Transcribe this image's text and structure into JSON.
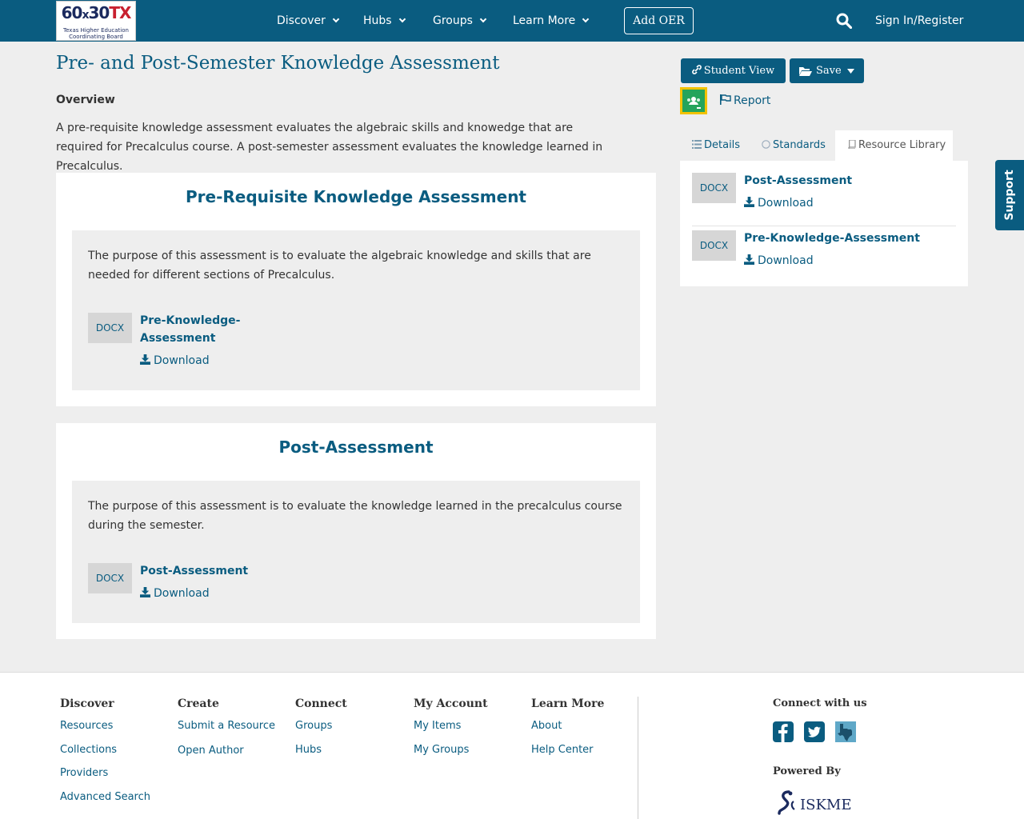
{
  "header": {
    "logo": {
      "line1": "60",
      "x": "x",
      "line2": "30",
      "tx": "TX",
      "sub1": "Texas Higher Education",
      "sub2": "Coordinating Board"
    },
    "nav": [
      "Discover",
      "Hubs",
      "Groups",
      "Learn More"
    ],
    "add_oer": "Add OER",
    "sign_in": "Sign In/Register"
  },
  "page": {
    "title": "Pre- and Post-Semester Knowledge Assessment",
    "overview_label": "Overview",
    "overview_text": "A pre-requisite knowledge assessment evaluates the algebraic skills and knowedge that are required for Precalculus course. A post-semester assessment evaluates the knowledge learned in Precalculus."
  },
  "sections": [
    {
      "title": "Pre-Requisite Knowledge Assessment",
      "description": "The purpose of this assessment is to evaluate the algebraic knowledge and skills that are needed for different sections of Precalculus.",
      "file_type": "DOCX",
      "file_name_line1": "Pre-Knowledge-",
      "file_name_line2": "Assessment",
      "download": "Download"
    },
    {
      "title": "Post-Assessment",
      "description": "The purpose of this assessment is to evaluate the knowledge learned in the precalculus course during the semester.",
      "file_type": "DOCX",
      "file_name": "Post-Assessment",
      "download": "Download"
    }
  ],
  "sidebar": {
    "student_view": "Student View",
    "save": "Save",
    "report": "Report",
    "tabs": [
      "Details",
      "Standards",
      "Resource Library"
    ],
    "library": [
      {
        "file_type": "DOCX",
        "name": "Post-Assessment",
        "download": "Download"
      },
      {
        "file_type": "DOCX",
        "name": "Pre-Knowledge-Assessment",
        "download": "Download"
      }
    ]
  },
  "support": "Support",
  "footer": {
    "columns": [
      {
        "title": "Discover",
        "links": [
          "Resources",
          "Collections",
          "Providers",
          "Advanced Search"
        ]
      },
      {
        "title": "Create",
        "links": [
          "Submit a Resource",
          "Open Author"
        ]
      },
      {
        "title": "Connect",
        "links": [
          "Groups",
          "Hubs"
        ]
      },
      {
        "title": "My Account",
        "links": [
          "My Items",
          "My Groups"
        ]
      },
      {
        "title": "Learn More",
        "links": [
          "About",
          "Help Center"
        ]
      }
    ],
    "connect_title": "Connect with us",
    "powered_by": "Powered By",
    "iskme": "ISKME"
  },
  "colors": {
    "brand": "#0a5c80",
    "background": "#eeeeee",
    "panel": "#ffffff",
    "file_badge": "#d6d6d6"
  }
}
